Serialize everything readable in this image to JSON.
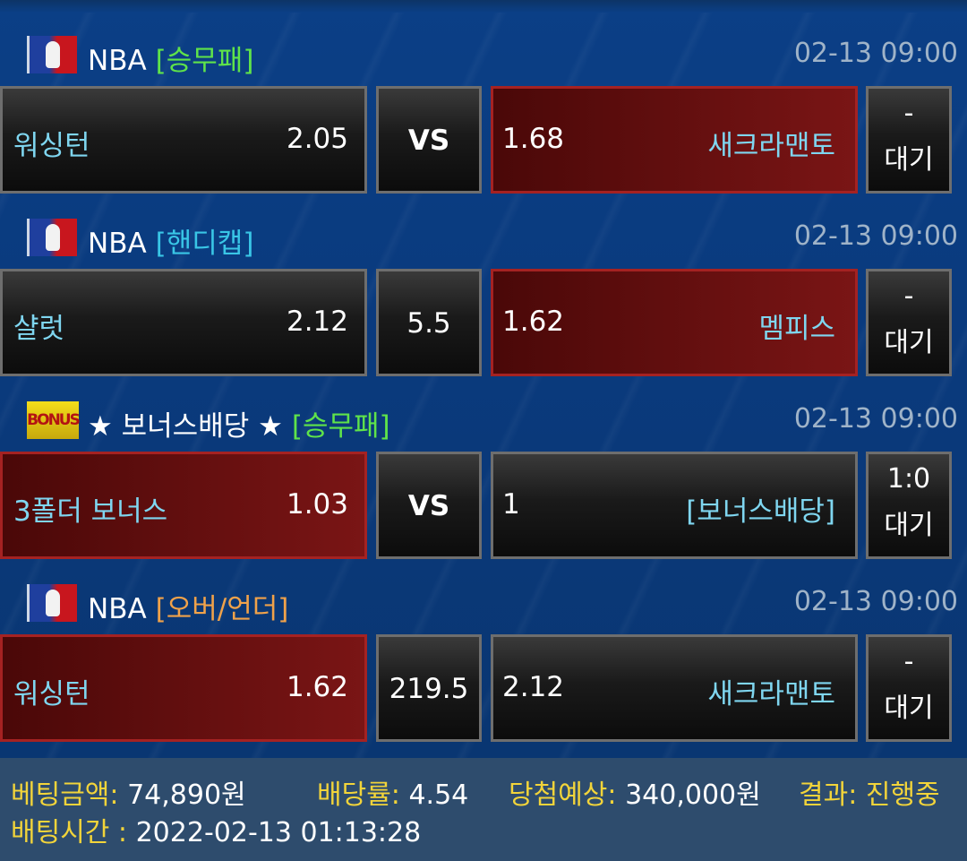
{
  "matches": [
    {
      "league": "NBA",
      "market": "[승무패]",
      "time": "02-13 09:00",
      "home_team": "워싱턴",
      "home_odds": "2.05",
      "middle": "VS",
      "away_odds": "1.68",
      "away_team": "새크라맨토",
      "status_top": "-",
      "status": "대기"
    },
    {
      "league": "NBA",
      "market": "[핸디캡]",
      "time": "02-13 09:00",
      "home_team": "샬럿",
      "home_odds": "2.12",
      "middle": "5.5",
      "away_odds": "1.62",
      "away_team": "멤피스",
      "status_top": "-",
      "status": "대기"
    },
    {
      "league": "★ 보너스배당 ★",
      "market": "[승무패]",
      "time": "02-13 09:00",
      "home_team": "3폴더 보너스",
      "home_odds": "1.03",
      "middle": "VS",
      "away_odds": "1",
      "away_team": "[보너스배당]",
      "status_top": "1:0",
      "status": "대기"
    },
    {
      "league": "NBA",
      "market": "[오버/언더]",
      "time": "02-13 09:00",
      "home_team": "워싱턴",
      "home_odds": "1.62",
      "middle": "219.5",
      "away_odds": "2.12",
      "away_team": "새크라맨토",
      "status_top": "-",
      "status": "대기"
    }
  ],
  "bonus_icon_text": "BONUS",
  "summary": {
    "bet_amount_label": "베팅금액:",
    "bet_amount": "74,890원",
    "odds_label": "배당률:",
    "odds": "4.54",
    "expected_label": "당첨예상:",
    "expected": "340,000원",
    "result_label": "결과:",
    "result": "진행중",
    "bet_time_label": "배팅시간 :",
    "bet_time": "2022-02-13 01:13:28"
  },
  "colors": {
    "background": "#0b3f86",
    "selected": "#7a1515",
    "team_text": "#7fd6f0",
    "summary_label": "#f2d43a",
    "summary_bg": "#2e4c6d"
  }
}
